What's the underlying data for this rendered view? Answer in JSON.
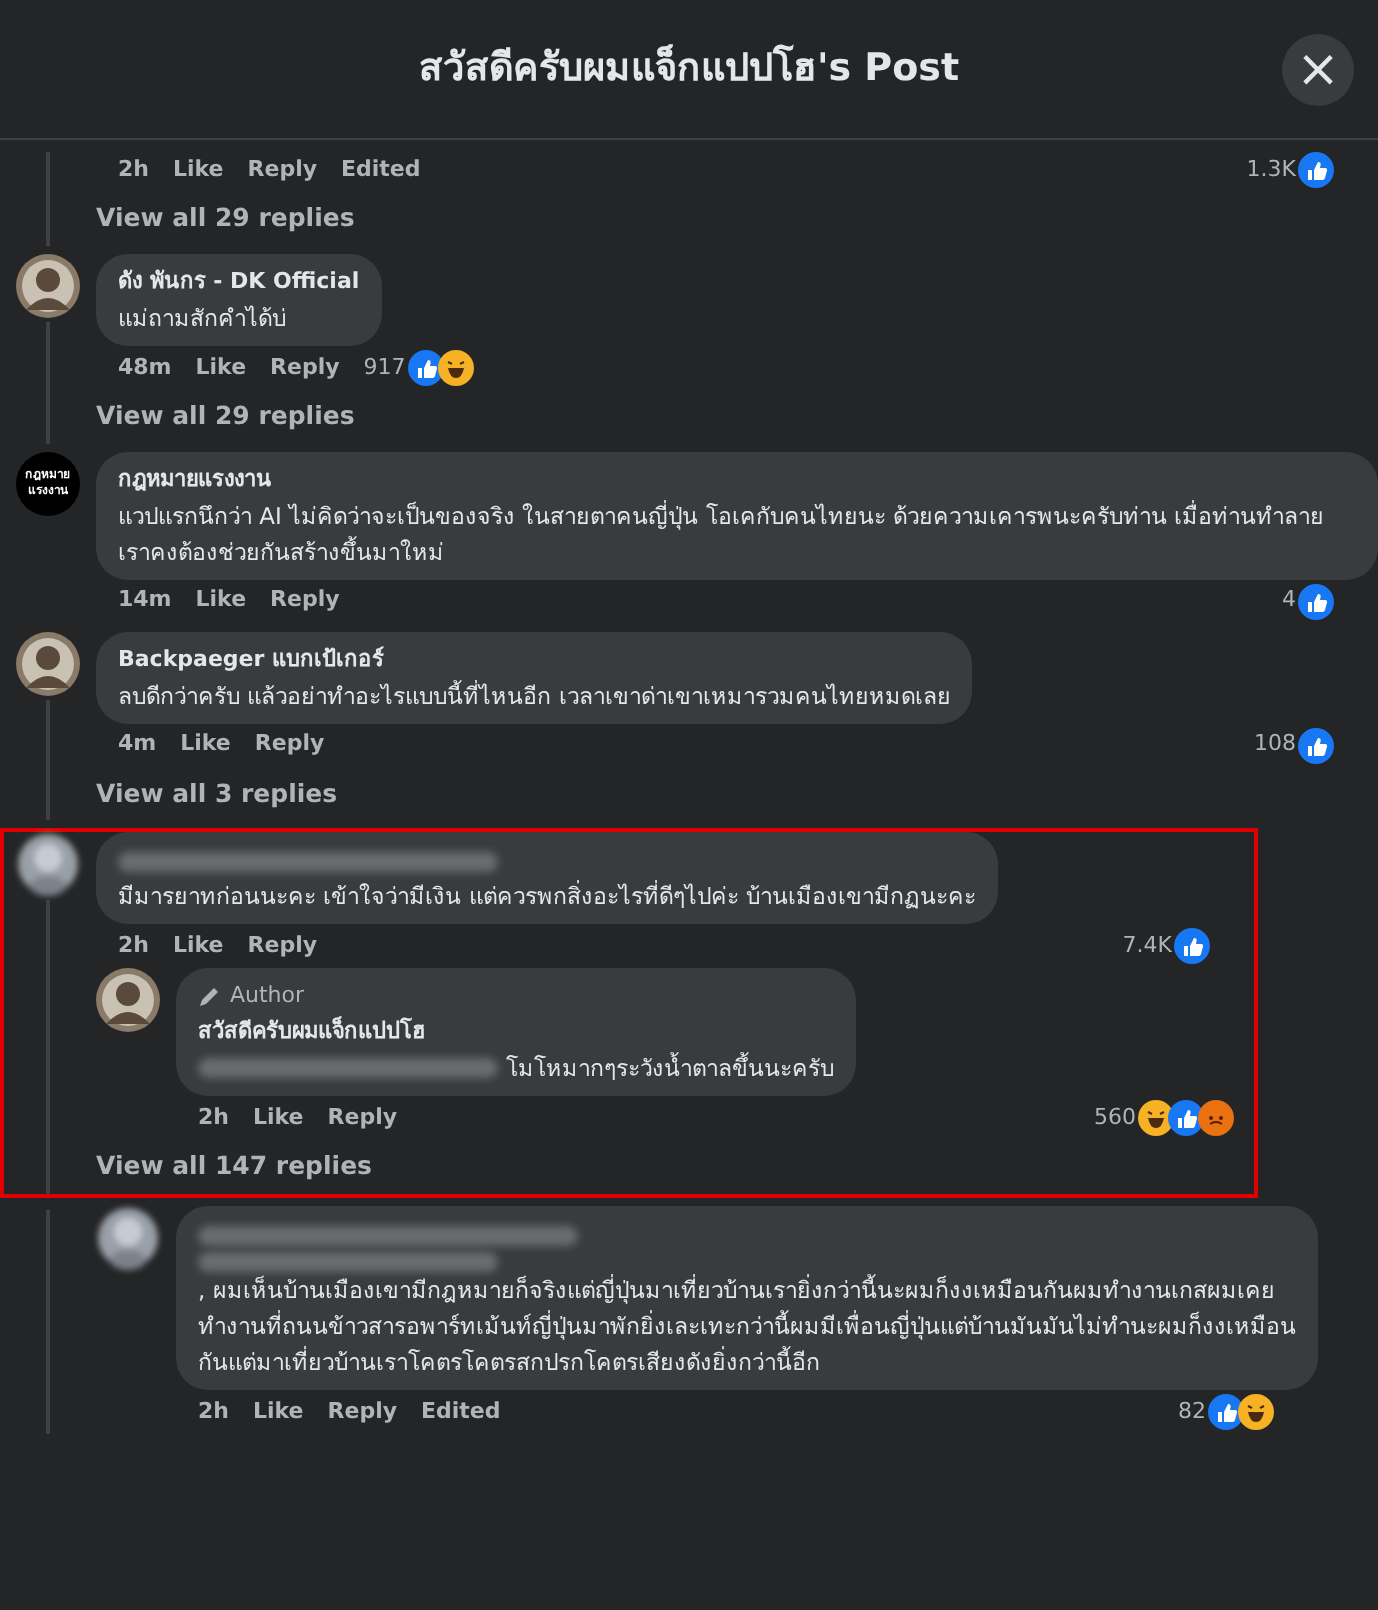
{
  "header": {
    "title": "สวัสดีครับผมแจ็กแปปโฮ's Post",
    "close": "×"
  },
  "comments": [
    {
      "partial": true,
      "time": "2h",
      "like": "Like",
      "reply": "Reply",
      "edited": "Edited",
      "count": "1.3K",
      "reactions": [
        {
          "kind": "like"
        }
      ],
      "view_all": "View all 29 replies"
    },
    {
      "avatar": {
        "kind": "person"
      },
      "author": "ดัง พันกร - DK Official",
      "text": "แม่ถามสักคำได้บ่",
      "time": "48m",
      "like": "Like",
      "reply": "Reply",
      "count": "917",
      "count_inline": true,
      "reactions": [
        {
          "kind": "like"
        },
        {
          "kind": "haha"
        }
      ],
      "view_all": "View all 29 replies"
    },
    {
      "avatar": {
        "kind": "logo",
        "label": [
          "กฎหมาย",
          "แรงงาน"
        ]
      },
      "author": "กฎหมายแรงงาน",
      "text": "แวปแรกนึกว่า AI ไม่คิดว่าจะเป็นของจริง ในสายตาคนญี่ปุ่น โอเคกับคนไทยนะ ด้วยความเคารพนะครับท่าน เมื่อท่านทำลาย เราคงต้องช่วยกันสร้างขึ้นมาใหม่",
      "time": "14m",
      "like": "Like",
      "reply": "Reply",
      "count": "4",
      "reactions": [
        {
          "kind": "like"
        }
      ]
    },
    {
      "avatar": {
        "kind": "person"
      },
      "author": "Backpaeger แบกเป้เกอร์",
      "text": "ลบดีกว่าครับ แล้วอย่าทำอะไรแบบนี้ที่ไหนอีก เวลาเขาด่าเขาเหมารวมคนไทยหมดเลย",
      "time": "4m",
      "like": "Like",
      "reply": "Reply",
      "count": "108",
      "reactions": [
        {
          "kind": "like"
        }
      ],
      "view_all": "View all 3 replies"
    },
    {
      "avatar": {
        "kind": "blurred"
      },
      "author_blurred": true,
      "highlighted": true,
      "text": "มีมารยาทก่อนนะคะ เข้าใจว่ามีเงิน แต่ควรพกสิ่งอะไรที่ดีๆไปค่ะ บ้านเมืองเขามีกฏนะคะ",
      "time": "2h",
      "like": "Like",
      "reply": "Reply",
      "count": "7.4K",
      "reactions": [
        {
          "kind": "like"
        }
      ],
      "replies": [
        {
          "avatar": {
            "kind": "person"
          },
          "badge": "Author",
          "author": "สวัสดีครับผมแจ็กแปปโฮ",
          "mention_blurred": true,
          "text": "โมโหมากๆระวังน้ำตาลขึ้นนะครับ",
          "time": "2h",
          "like": "Like",
          "reply": "Reply",
          "count": "560",
          "reactions": [
            {
              "kind": "haha"
            },
            {
              "kind": "like"
            },
            {
              "kind": "angry"
            }
          ]
        }
      ],
      "view_all": "View all 147 replies"
    },
    {
      "reply_level": true,
      "avatar": {
        "kind": "blurred"
      },
      "author_blurred": true,
      "mention_blurred": true,
      "text": ", ผมเห็นบ้านเมืองเขามีกฎหมายก็จริงแต่ญี่ปุ่นมาเที่ยวบ้านเรายิ่งกว่านี้นะผมก็งงเหมือนกันผมทำงานเกสผมเคยทำงานที่ถนนข้าวสารอพาร์ทเม้นท์ญี่ปุ่นมาพักยิ่งเละเทะกว่านี้ผมมีเพื่อนญี่ปุ่นแต่บ้านมันมันไม่ทำนะผมก็งงเหมือนกันแต่มาเที่ยวบ้านเราโคตรโคตรสกปรกโคตรเสียงดังยิ่งกว่านี้อีก",
      "time": "2h",
      "like": "Like",
      "reply": "Reply",
      "edited": "Edited",
      "count": "82",
      "reactions": [
        {
          "kind": "like"
        },
        {
          "kind": "haha"
        }
      ]
    }
  ]
}
